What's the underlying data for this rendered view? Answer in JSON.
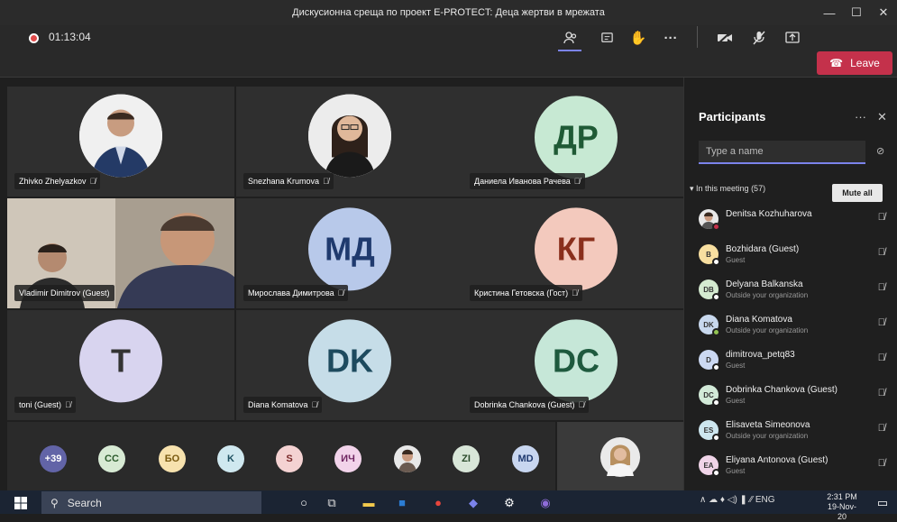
{
  "window": {
    "title": "Дискусионна среща по проект E-PROTECT: Деца жертви в мрежата"
  },
  "meeting": {
    "timer": "01:13:04",
    "leave_label": "Leave"
  },
  "tiles": [
    {
      "name": "Zhivko Zhelyazkov"
    },
    {
      "name": "Snezhana Krumova"
    },
    {
      "name": "Даниела Иванова Рачева",
      "initials": "ДР"
    },
    {
      "name": "Vladimir Dimitrov (Guest)"
    },
    {
      "name": "Мирослава Димитрова",
      "initials": "МД"
    },
    {
      "name": "Кристина Гетовска (Гост)",
      "initials": "КГ"
    },
    {
      "name": "toni (Guest)",
      "initials": "T"
    },
    {
      "name": "Diana Komatova",
      "initials": "DK"
    },
    {
      "name": "Dobrinka Chankova (Guest)",
      "initials": "DC"
    }
  ],
  "strip": [
    "+39",
    "CC",
    "БО",
    "K",
    "S",
    "ИЧ",
    "ZI",
    "MD"
  ],
  "panel": {
    "title": "Participants",
    "more": "···",
    "close": "✕",
    "search_placeholder": "Type a name",
    "section": "In this meeting (57)",
    "mute_all": "Mute all",
    "participants": [
      {
        "name": "Denitsa Kozhuharova",
        "sub": "",
        "initials": ""
      },
      {
        "name": "Bozhidara (Guest)",
        "sub": "Guest",
        "initials": "B"
      },
      {
        "name": "Delyana Balkanska",
        "sub": "Outside your organization",
        "initials": "DB"
      },
      {
        "name": "Diana Komatova",
        "sub": "Outside your organization",
        "initials": "DK"
      },
      {
        "name": "dimitrova_petq83",
        "sub": "Guest",
        "initials": "D"
      },
      {
        "name": "Dobrinka Chankova (Guest)",
        "sub": "Guest",
        "initials": "DC"
      },
      {
        "name": "Elisaveta Simeonova",
        "sub": "Outside your organization",
        "initials": "ES"
      },
      {
        "name": "Eliyana Antonova (Guest)",
        "sub": "Guest",
        "initials": "EA"
      }
    ]
  },
  "taskbar": {
    "search": "Search",
    "lang": "ENG",
    "time": "2:31 PM",
    "date": "19-Nov-20"
  }
}
